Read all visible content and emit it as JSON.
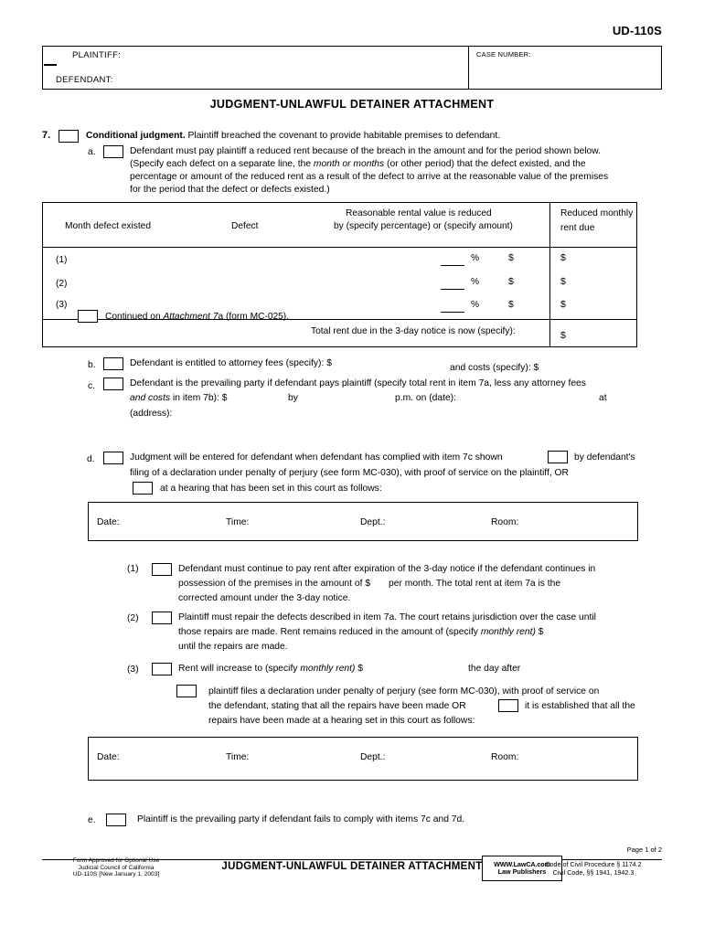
{
  "form_number": "UD-110S",
  "caption": {
    "plaintiff_label": "PLAINTIFF:",
    "defendant_label": "DEFENDANT:",
    "case_number_label": "CASE NUMBER:"
  },
  "document_title": "JUDGMENT-UNLAWFUL DETAINER ATTACHMENT",
  "item7": {
    "number": "7.",
    "heading_bold": "Conditional judgment.",
    "heading_rest": " Plaintiff breached the covenant to provide habitable premises to defendant.",
    "a": {
      "marker": "a.",
      "line1": "Defendant must pay plaintiff a reduced rent because of the breach in the amount and for the period shown below.",
      "line2_pre": "(Specify each defect on a separate line, the ",
      "line2_em": "month or months",
      "line2_post": " (or other period) that the defect existed, and the",
      "line3": "percentage or amount of the reduced rent as a result of the defect to arrive at the reasonable value of the premises",
      "line4": "for the period that the defect or defects existed.)"
    },
    "b": {
      "marker": "b.",
      "text": "Defendant is entitled to attorney fees (specify): $",
      "costs_text": "and costs (specify): $"
    },
    "c": {
      "marker": "c.",
      "line1": "Defendant is the prevailing party if defendant pays plaintiff (specify total rent in item 7a, less any attorney fees",
      "line2_em": "and costs",
      "line2_post": " in item 7b): $",
      "line2_by": "by",
      "line2_pm": "p.m. on (date):",
      "line2_at": "at",
      "line3": "(address):"
    },
    "d": {
      "marker": "d.",
      "line1": "Judgment will be entered for defendant when defendant has complied with item 7c shown",
      "line1_tail": "by defendant's",
      "line2": "filing of a declaration under penalty of perjury (see form MC-030), with proof of service on the plaintiff, OR",
      "line3": "at a hearing that has been set in this court as follows:"
    },
    "d1": {
      "marker": "(1)",
      "line1": "Defendant must continue to pay rent after expiration of the 3-day notice if the defendant continues in",
      "line2_pre": "possession of the premises in the amount of $",
      "line2_post": "per month. The total rent at item 7a is the",
      "line3": "corrected amount under the 3-day notice."
    },
    "d2": {
      "marker": "(2)",
      "line1": "Plaintiff must repair the defects described in item 7a. The court retains jurisdiction over the case until",
      "line2_pre": "those repairs are made. Rent remains reduced in the amount of (specify ",
      "line2_em": "monthly rent)",
      "line2_post": " $",
      "line3": "until the repairs are made."
    },
    "d3": {
      "marker": "(3)",
      "line1_pre": "Rent will increase to (specify ",
      "line1_em": "monthly rent)",
      "line1_post": " $",
      "line1_tail": "the day after",
      "sub_line1": "plaintiff files a declaration under penalty of perjury (see form MC-030), with proof of service on",
      "sub_line2": "the defendant, stating that all the repairs have been made OR",
      "sub_line2_tail": "it is established that all the",
      "sub_line3": "repairs have been made at a hearing set in this court as follows:"
    },
    "e": {
      "marker": "e.",
      "text": "Plaintiff is the prevailing party if defendant fails to comply with items 7c and 7d."
    }
  },
  "table": {
    "headers": {
      "col1": "Month defect existed",
      "col2": "Defect",
      "col3_line1": "Reasonable rental value is reduced",
      "col3_line2": "by (specify percentage) or (specify amount)",
      "col4_line1": "Reduced monthly",
      "col4_line2": "rent due"
    },
    "rows": [
      {
        "label": "(1)",
        "percent_symbol": "%",
        "dollar": "$",
        "reduced_dollar": "$"
      },
      {
        "label": "(2)",
        "percent_symbol": "%",
        "dollar": "$",
        "reduced_dollar": "$"
      },
      {
        "label": "(3)",
        "percent_symbol": "%",
        "dollar": "$",
        "reduced_dollar": "$"
      }
    ],
    "continued_pre": "Continued on ",
    "continued_em": "Attachment 7",
    "continued_post": "a (form MC-025).",
    "total_label": "Total rent due in the 3-day notice is now (specify):",
    "total_dollar": "$"
  },
  "hearing_box_1": {
    "date": "Date:",
    "time": "Time:",
    "dept": "Dept.:",
    "room": "Room:"
  },
  "hearing_box_2": {
    "date": "Date:",
    "time": "Time:",
    "dept": "Dept.:",
    "room": "Room:"
  },
  "footer": {
    "page": "Page 1 of 2",
    "approved_line1": "Form Approved for Optional Use",
    "approved_line2": "Judicial Council of California",
    "approved_line3": "UD-110S [New January 1, 2003]",
    "title": "JUDGMENT-UNLAWFUL DETAINER ATTACHMENT",
    "publisher_line1": "WWW.LawCA.com",
    "publisher_line2": "Law Publishers",
    "citation_line1": "Code of Civil Procedure § 1174.2",
    "citation_line2": "Civil Code, §§ 1941, 1942.3"
  }
}
